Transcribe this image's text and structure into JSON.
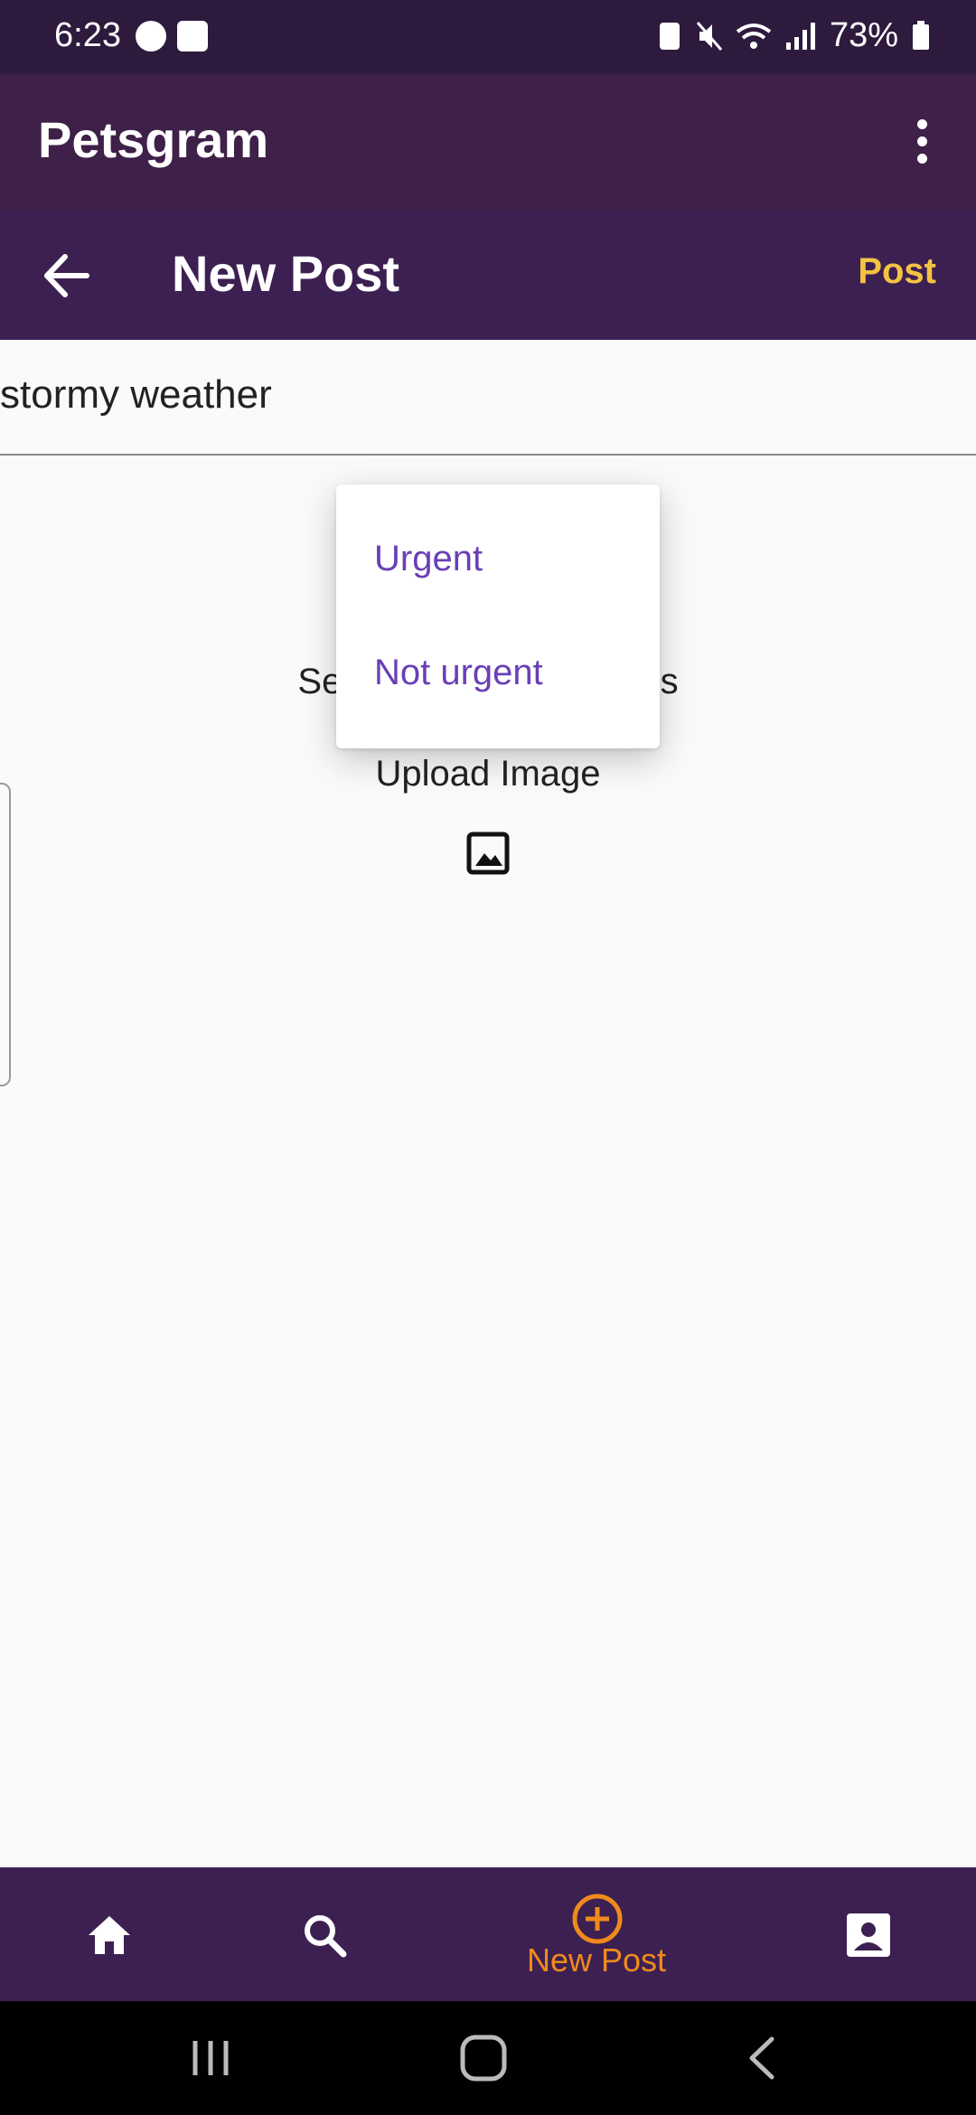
{
  "status_bar": {
    "time": "6:23",
    "battery": "73%"
  },
  "app_bar": {
    "title": "Petsgram"
  },
  "sub_bar": {
    "title": "New Post",
    "post_label": "Post"
  },
  "caption": {
    "value": "stormy weather"
  },
  "body": {
    "select_label_left": "Sele",
    "select_label_right": "ins",
    "upload_label": "Upload Image"
  },
  "dropdown": {
    "options": [
      "Urgent",
      "Not urgent"
    ]
  },
  "bottom_nav": {
    "items": [
      {
        "icon": "home-icon",
        "label": ""
      },
      {
        "icon": "search-icon",
        "label": ""
      },
      {
        "icon": "add-circle-icon",
        "label": "New Post"
      },
      {
        "icon": "profile-icon",
        "label": ""
      }
    ]
  },
  "colors": {
    "status_bar": "#2e1a3d",
    "app_bar": "#3e2048",
    "sub_bar": "#3d2052",
    "accent_yellow": "#f5c342",
    "accent_orange": "#f08a1c",
    "dropdown_text": "#6a3fb5"
  }
}
